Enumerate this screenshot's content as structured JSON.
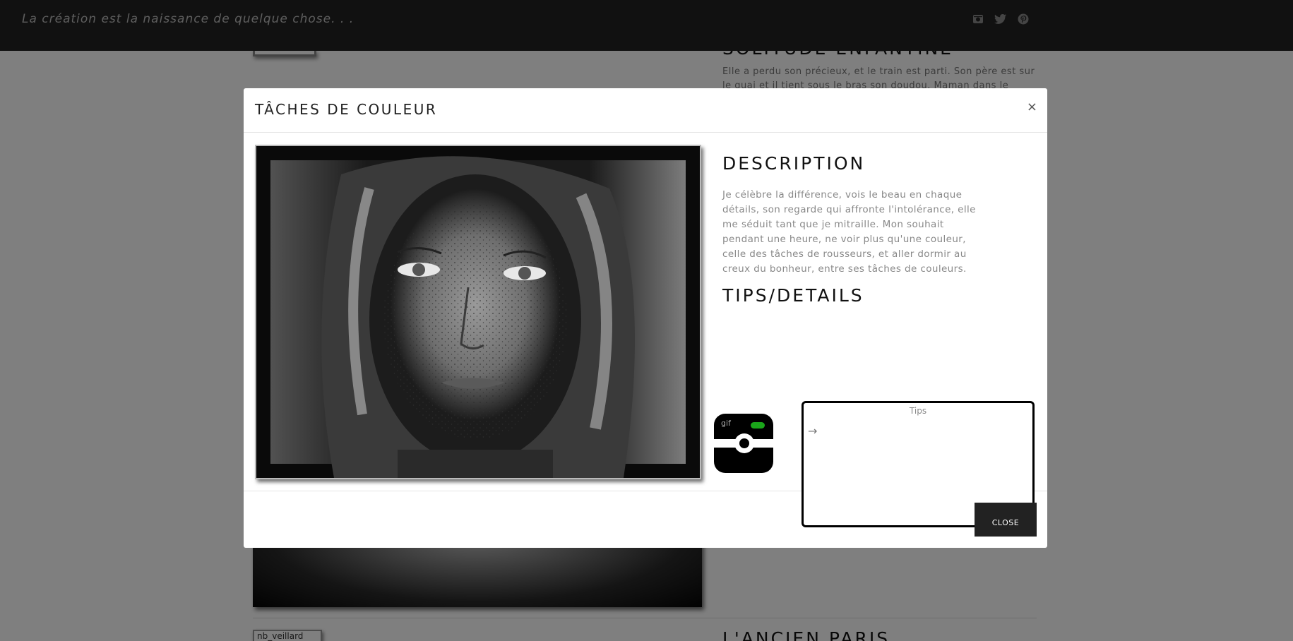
{
  "header": {
    "tagline": "La création est la naissance de quelque chose. . ."
  },
  "social": [
    {
      "icon": "instagram-icon"
    },
    {
      "icon": "twitter-icon"
    },
    {
      "icon": "pinterest-icon"
    }
  ],
  "background": {
    "title_top": "SOLITUDE ENFANTINE",
    "text_top": "Elle a perdu son précieux, et le train est parti. Son père est sur le quai et il tient sous le bras son doudou. Maman dans le",
    "title_bottom": "L'ANCIEN PARIS",
    "broken_image_alt": "nb_veillard"
  },
  "modal": {
    "title": "TÂCHES DE COULEUR",
    "close_symbol": "×",
    "description_heading": "DESCRIPTION",
    "description": "Je célèbre la différence, vois le beau en chaque détails, son regarde qui affronte l'intolérance, elle me séduit tant que je mitraille. Mon souhait pendant une heure, ne voir plus qu'une couleur, celle des tâches de rousseurs, et aller dormir au creux du bonheur, entre ses tâches de couleurs.",
    "tips_heading": "TIPS/DETAILS",
    "tips_label": "Tips",
    "tips_arrow": "→",
    "cam_alt": "gif",
    "close_button": "CLOSE"
  },
  "colors": {
    "topbar": "#222222",
    "overlay": "rgba(0,0,0,0.5)",
    "button": "#222222",
    "cam_led": "#1aa51a"
  }
}
